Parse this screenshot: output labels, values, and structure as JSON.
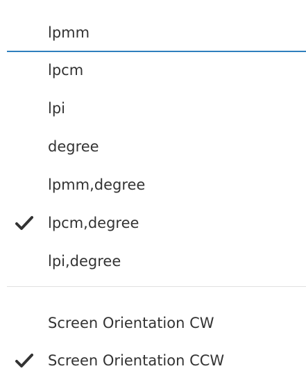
{
  "menu": {
    "items": [
      {
        "label": "lpmm",
        "checked": false
      },
      {
        "label": "lpcm",
        "checked": false
      },
      {
        "label": "lpi",
        "checked": false
      },
      {
        "label": "degree",
        "checked": false
      },
      {
        "label": "lpmm,degree",
        "checked": false
      },
      {
        "label": "lpcm,degree",
        "checked": true
      },
      {
        "label": "lpi,degree",
        "checked": false
      },
      {
        "label": "Screen Orientation CW",
        "checked": false
      },
      {
        "label": "Screen Orientation CCW",
        "checked": true
      }
    ],
    "colors": {
      "text": "#333333",
      "accent_separator": "#2f7fbd",
      "separator": "#e1e1e1",
      "checkmark": "#333333"
    },
    "icons": {
      "checked": "checkmark-icon"
    }
  }
}
